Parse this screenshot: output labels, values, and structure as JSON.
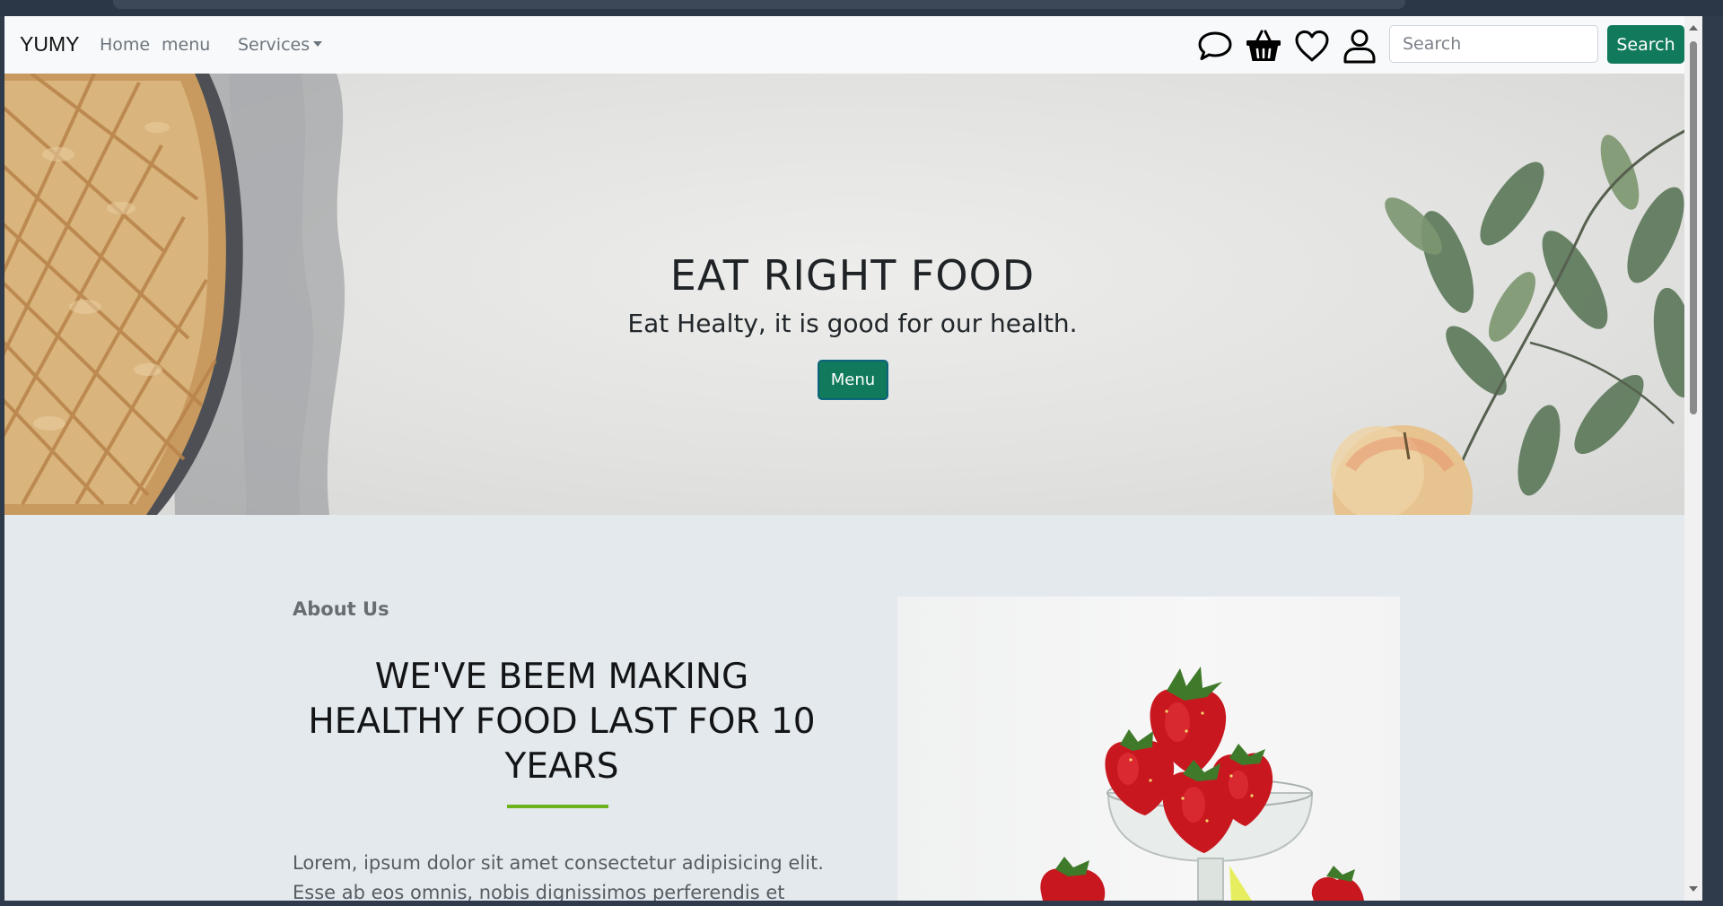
{
  "navbar": {
    "brand": "YUMY",
    "links": [
      "Home",
      "menu"
    ],
    "services_label": "Services",
    "search_placeholder": "Search",
    "search_button": "Search"
  },
  "icons": [
    "chat-icon",
    "basket-icon",
    "heart-icon",
    "user-icon"
  ],
  "hero": {
    "title": "EAT RIGHT FOOD",
    "subtitle": "Eat Healty, it is good for our health.",
    "button": "Menu"
  },
  "about": {
    "label": "About Us",
    "heading": "WE'VE BEEM MAKING HEALTHY FOOD LAST FOR 10 YEARS",
    "text": "Lorem, ipsum dolor sit amet consectetur adipisicing elit. Esse ab eos omnis, nobis dignissimos perferendis et officia"
  },
  "colors": {
    "accent": "#127a5c",
    "rule": "#6cb21d",
    "page_bg": "#e4e9ee"
  }
}
